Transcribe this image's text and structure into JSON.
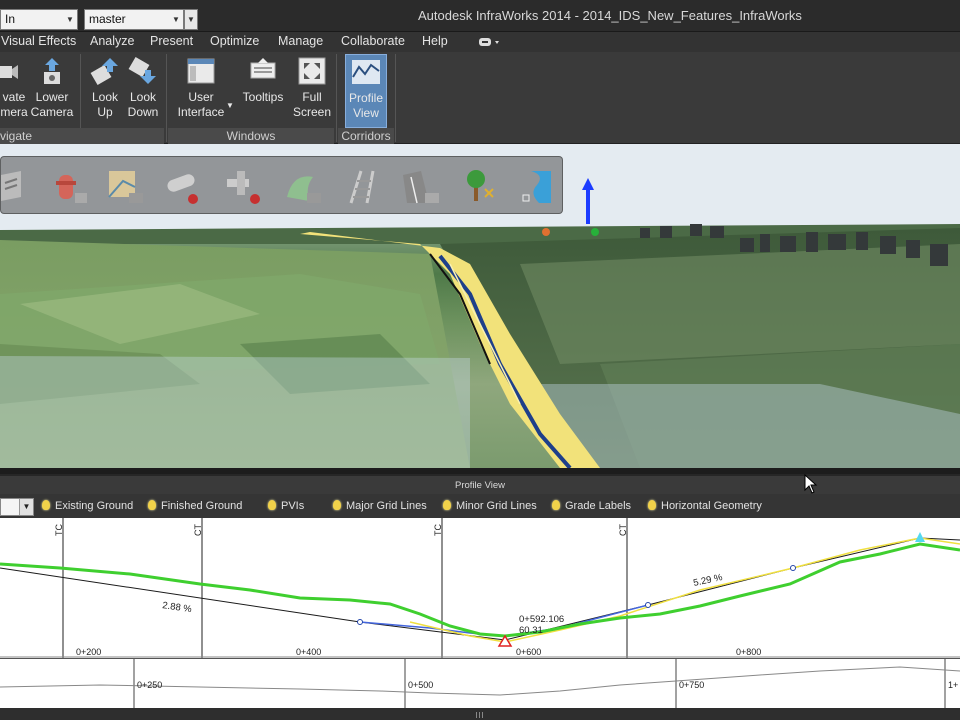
{
  "titlebar": {
    "zoom_combo": "In",
    "branch_combo": "master",
    "title": "Autodesk InfraWorks 2014 - 2014_IDS_New_Features_InfraWorks"
  },
  "menu": [
    "Visual Effects",
    "Analyze",
    "Present",
    "Optimize",
    "Manage",
    "Collaborate",
    "Help"
  ],
  "ribbon": {
    "elevate_camera": [
      "vate",
      "mera"
    ],
    "lower_camera": [
      "Lower",
      "Camera"
    ],
    "look_up": [
      "Look",
      "Up"
    ],
    "look_down": [
      "Look",
      "Down"
    ],
    "user_interface": [
      "User",
      "Interface"
    ],
    "tooltips": "Tooltips",
    "full_screen": [
      "Full",
      "Screen"
    ],
    "profile_view": [
      "Profile",
      "View"
    ],
    "panels": {
      "navigate": "vigate",
      "windows": "Windows",
      "corridors": "Corridors"
    }
  },
  "viewport": {
    "tools": [
      "roads-icon",
      "hydrant-icon",
      "land-parcel-icon",
      "pipe-icon",
      "pipe-connector-icon",
      "coverage-icon",
      "railway-icon",
      "bridge-icon",
      "tree-icon",
      "water-icon"
    ]
  },
  "profile_view": {
    "title": "Profile View",
    "legend": [
      "Existing Ground",
      "Finished Ground",
      "PVIs",
      "Major Grid Lines",
      "Minor Grid Lines",
      "Grade Labels",
      "Horizontal Geometry"
    ],
    "markers": [
      "TC",
      "CT",
      "TC",
      "CT"
    ],
    "grade_labels": [
      "2.88 %",
      "5.29 %"
    ],
    "pvi_station": "0+592.106",
    "pvi_elevation": "60.31",
    "stations": [
      "0+200",
      "0+400",
      "0+600",
      "0+800"
    ],
    "overview_stations": [
      "0+250",
      "0+500",
      "0+750",
      "1+"
    ]
  },
  "colors": {
    "ribbon_active": "#5b87b7",
    "existing_ground": "#3fcf2f",
    "finished_ground": "#f0e040",
    "pvi_line": "#1a1a1a",
    "horizontal_geometry": "#4466dd"
  }
}
